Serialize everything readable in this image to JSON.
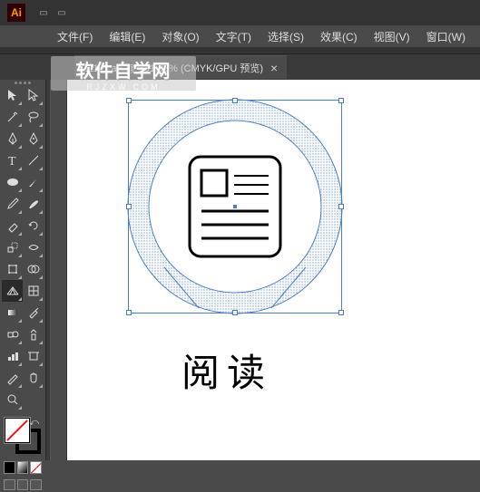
{
  "app": {
    "logo_text": "Ai"
  },
  "menu": {
    "items": [
      "文件(F)",
      "编辑(E)",
      "对象(O)",
      "文字(T)",
      "选择(S)",
      "效果(C)",
      "视图(V)",
      "窗口(W)"
    ]
  },
  "tab": {
    "label": "11111.ai* @ 131.83% (CMYK/GPU 预览)",
    "close": "×"
  },
  "artwork": {
    "label": "阅读"
  },
  "watermark": {
    "main": "软件自学网",
    "sub": "RJZXW.COM"
  },
  "colors": {
    "selection": "#4a7dc7",
    "accent": "#ff9a00"
  }
}
